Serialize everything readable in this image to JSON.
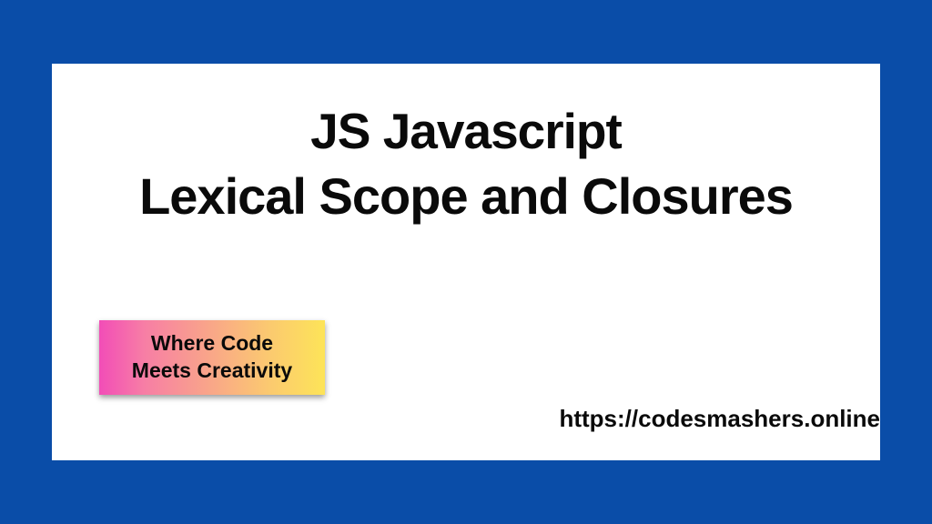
{
  "title": {
    "line1": "JS Javascript",
    "line2": "Lexical Scope and Closures"
  },
  "tagline": {
    "line1": "Where Code",
    "line2": "Meets Creativity"
  },
  "url": "https://codesmashers.online"
}
